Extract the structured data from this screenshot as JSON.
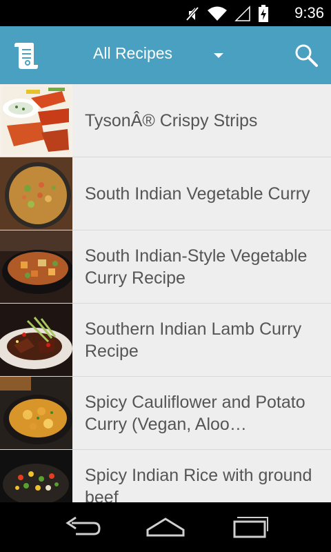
{
  "status": {
    "time": "9:36"
  },
  "actionbar": {
    "title": "All Recipes"
  },
  "recipes": [
    {
      "title": "TysonÂ® Crispy Strips"
    },
    {
      "title": "South Indian Vegetable Curry"
    },
    {
      "title": "South Indian-Style Vegetable Curry Recipe"
    },
    {
      "title": "Southern Indian Lamb Curry Recipe"
    },
    {
      "title": "Spicy Cauliflower and Potato Curry (Vegan, Aloo…"
    },
    {
      "title": "Spicy Indian Rice with ground beef"
    }
  ],
  "colors": {
    "actionbar": "#4aa0c0",
    "list_bg": "#eeeeee",
    "text": "#555555"
  }
}
